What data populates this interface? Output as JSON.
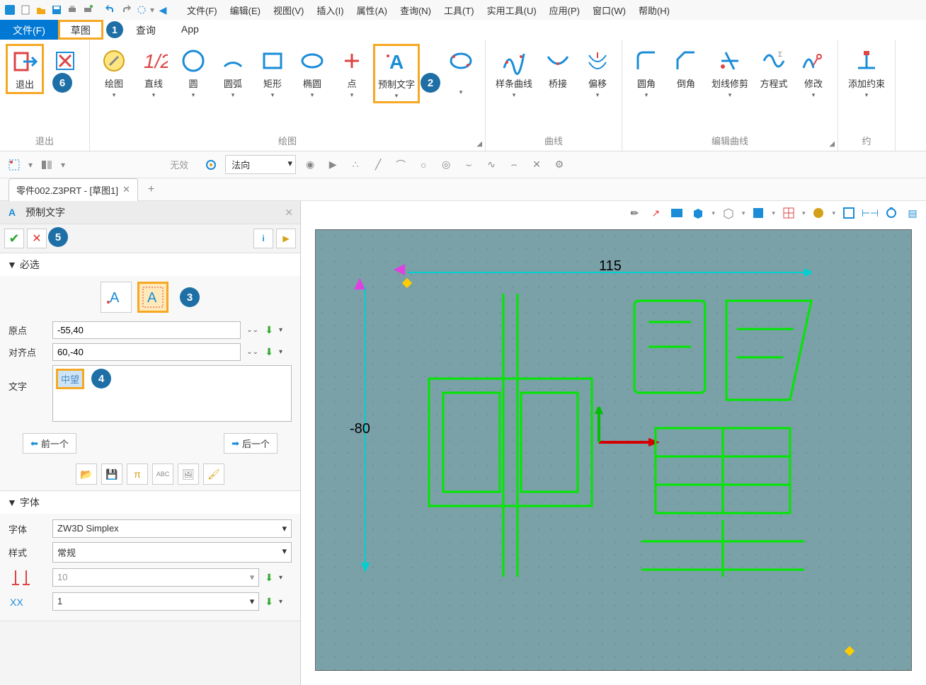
{
  "menubar": {
    "items": [
      "文件(F)",
      "编辑(E)",
      "视图(V)",
      "插入(I)",
      "属性(A)",
      "查询(N)",
      "工具(T)",
      "实用工具(U)",
      "应用(P)",
      "窗口(W)",
      "帮助(H)"
    ]
  },
  "tabbar": {
    "tabs": [
      {
        "label": "文件(F)",
        "active": true
      },
      {
        "label": "草图",
        "highlight": true,
        "num": "1"
      },
      {
        "label": "查询"
      },
      {
        "label": "App"
      }
    ]
  },
  "ribbon": {
    "groups": [
      {
        "label": "退出",
        "items": [
          {
            "label": "退出",
            "highlight": true
          },
          {
            "label": "",
            "x_icon": true,
            "num": "6"
          }
        ]
      },
      {
        "label": "绘图",
        "items": [
          {
            "label": "绘图"
          },
          {
            "label": "直线"
          },
          {
            "label": "圆"
          },
          {
            "label": "圆弧"
          },
          {
            "label": "矩形"
          },
          {
            "label": "椭圆"
          },
          {
            "label": "点"
          },
          {
            "label": "预制文字",
            "highlight": true,
            "num": "2"
          }
        ],
        "launcher": true
      },
      {
        "label": "曲线",
        "items": [
          {
            "label": "样条曲线"
          },
          {
            "label": "桥接"
          },
          {
            "label": "偏移"
          }
        ]
      },
      {
        "label": "编辑曲线",
        "items": [
          {
            "label": "圆角"
          },
          {
            "label": "倒角"
          },
          {
            "label": "划线修剪"
          },
          {
            "label": "方程式"
          },
          {
            "label": "修改"
          }
        ],
        "launcher": true
      },
      {
        "label": "约",
        "items": [
          {
            "label": "添加约束"
          }
        ]
      }
    ]
  },
  "toolbar2": {
    "invalid": "无效",
    "normal": "法向"
  },
  "doctab": {
    "label": "零件002.Z3PRT - [草图1]"
  },
  "panel": {
    "title": "预制文字",
    "num5": "5",
    "required": "必选",
    "num3": "3",
    "origin_label": "原点",
    "origin_value": "-55,40",
    "align_label": "对齐点",
    "align_value": "60,-40",
    "text_label": "文字",
    "text_chip": "中望",
    "num4": "4",
    "prev": "前一个",
    "next": "后一个",
    "font_section": "字体",
    "font_label": "字体",
    "font_value": "ZW3D Simplex",
    "style_label": "样式",
    "style_value": "常规",
    "size1": "10",
    "size2": "1"
  },
  "canvas": {
    "dim_h": "115",
    "dim_v": "-80"
  }
}
